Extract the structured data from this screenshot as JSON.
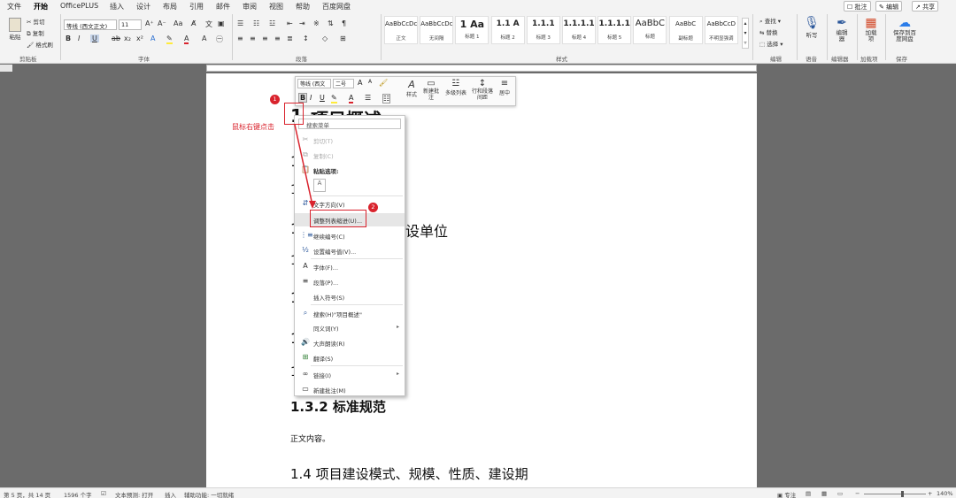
{
  "menubar": {
    "tabs": [
      "文件",
      "开始",
      "OfficePLUS",
      "插入",
      "设计",
      "布局",
      "引用",
      "邮件",
      "审阅",
      "视图",
      "帮助",
      "百度网盘"
    ],
    "active": "开始",
    "right_buttons": [
      "批注",
      "编辑",
      "共享"
    ]
  },
  "ribbon": {
    "clipboard": {
      "paste": "粘贴",
      "cut": "剪切",
      "copy": "复制",
      "format_painter": "格式刷",
      "label": "剪贴板"
    },
    "font": {
      "font_name": "等线 (西文正文)",
      "font_size": "11",
      "label": "字体"
    },
    "paragraph": {
      "label": "段落"
    },
    "styles": {
      "label": "样式",
      "cards": [
        {
          "sample": "AaBbCcDc",
          "name": "正文"
        },
        {
          "sample": "AaBbCcDc",
          "name": "无间隔"
        },
        {
          "sample": "1 Aa",
          "name": "标题 1"
        },
        {
          "sample": "1.1 A",
          "name": "标题 2"
        },
        {
          "sample": "1.1.1",
          "name": "标题 3"
        },
        {
          "sample": "1.1.1.1",
          "name": "标题 4"
        },
        {
          "sample": "1.1.1.1",
          "name": "标题 5"
        },
        {
          "sample": "AaBbC",
          "name": "标题"
        },
        {
          "sample": "AaBbC",
          "name": "副标题"
        },
        {
          "sample": "AaBbCcD",
          "name": "不明显强调"
        }
      ]
    },
    "editing": {
      "find": "查找",
      "replace": "替换",
      "select": "选择",
      "label": "编辑"
    },
    "voice": {
      "dictate": "听写",
      "label": "语音"
    },
    "editor": {
      "btn": "编辑器",
      "label": "编辑器"
    },
    "addins": {
      "btn": "加载项",
      "label": "加载项"
    },
    "save": {
      "btn": "保存到百度网盘",
      "label": "保存"
    }
  },
  "document": {
    "heading1_num": "1",
    "heading1_text": "项目概述",
    "partial_1": "1",
    "partial_2": "1",
    "partial_3": "1",
    "partial_4": "1",
    "partial_5": "1",
    "partial_6": "1",
    "partial_7": "1",
    "partial_8": "1",
    "heading_unit": "设单位",
    "heading_132": "1.3.2 标准规范",
    "body_text": "正文内容。",
    "heading_14": "1.4  项目建设模式、规模、性质、建设期"
  },
  "mini_toolbar": {
    "font_name": "等线 (西文",
    "font_size": "二号",
    "styles": "样式",
    "new_comment": "新建批注",
    "multilevel_list": "多级列表",
    "line_spacing": "行和段落间距",
    "center": "居中"
  },
  "context_menu": {
    "search_placeholder": "搜索菜单",
    "items": {
      "cut": "剪切(T)",
      "copy": "复制(C)",
      "paste_options": "粘贴选项:",
      "text_direction": "文字方向(V)",
      "adjust_list_indent": "调整列表缩进(U)...",
      "continue_numbering": "继续编号(C)",
      "set_numbering_value": "设置编号值(V)...",
      "font": "字体(F)...",
      "paragraph": "段落(P)...",
      "insert_symbol": "插入符号(S)",
      "search": "搜索(H)\"项目概述\"",
      "synonyms": "同义词(Y)",
      "read_aloud": "大声朗读(R)",
      "translate": "翻译(S)",
      "link": "链接(I)",
      "new_comment": "新建批注(M)"
    }
  },
  "annotations": {
    "badge1": "1",
    "badge2": "2",
    "note": "鼠标右键点击"
  },
  "statusbar": {
    "page": "第 5 页，共 14 页",
    "words": "1596 个字",
    "predict": "文本预测: 打开",
    "insert": "插入",
    "accessibility": "辅助功能: 一切就绪",
    "focus": "专注",
    "zoom": "140%"
  }
}
